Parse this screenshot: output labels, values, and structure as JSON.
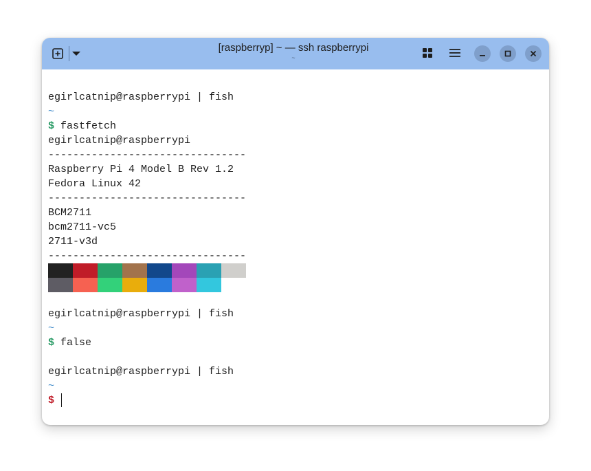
{
  "window": {
    "title": "[raspberryp] ~ — ssh raspberrypi",
    "subtitle": "~"
  },
  "icons": {
    "new_tab": "new-tab-icon",
    "dropdown": "chevron-down-icon",
    "grid": "grid-icon",
    "menu": "hamburger-menu-icon",
    "minimize": "minimize-icon",
    "maximize": "maximize-icon",
    "close": "close-icon"
  },
  "terminal": {
    "block1": {
      "header": "egirlcatnip@raspberrypi | fish",
      "cwd": "~",
      "prompt": "$",
      "command": "fastfetch"
    },
    "fastfetch": {
      "user_host": "egirlcatnip@raspberrypi",
      "separator": "--------------------------------",
      "host": "Raspberry Pi 4 Model B Rev 1.2",
      "os": "Fedora Linux 42",
      "cpu": "BCM2711",
      "gpu1": "bcm2711-vc5",
      "gpu2": "2711-v3d",
      "palette_row1": [
        "#222222",
        "#c01c28",
        "#26a269",
        "#a2734c",
        "#12488b",
        "#a347ba",
        "#2aa1b3",
        "#d0cfcc"
      ],
      "palette_row2": [
        "#5e5c64",
        "#f66151",
        "#33d17a",
        "#e9ad0c",
        "#2a7bde",
        "#c061cb",
        "#33c7de"
      ]
    },
    "block2": {
      "header": "egirlcatnip@raspberrypi | fish",
      "cwd": "~",
      "prompt": "$",
      "command": "false"
    },
    "block3": {
      "header": "egirlcatnip@raspberrypi | fish",
      "cwd": "~",
      "prompt": "$",
      "command": ""
    }
  },
  "colors": {
    "titlebar": "#98bdee",
    "prompt_success": "#2a9b66",
    "prompt_error": "#c01c28",
    "tilde": "#3a87c8"
  }
}
